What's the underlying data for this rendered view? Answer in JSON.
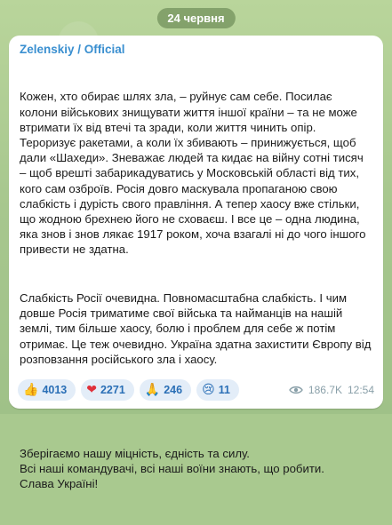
{
  "date_label": "24 червня",
  "channel": "Zelenskiy / Official",
  "paragraphs": [
    "Кожен, хто обирає шлях зла, – руйнує сам себе. Посилає колони військових знищувати життя іншої країни – та не може втримати їх від втечі та зради, коли життя чинить опір. Тероризує ракетами, а коли їх збивають – принижується, щоб дали «Шахеди». Зневажає людей та кидає на війну сотні тисяч – щоб врешті забарикадуватись у Московській області від тих, кого сам озброїв. Росія довго маскувала пропаганою свою слабкість і дурість свого правління. А тепер хаосу вже стільки, що жодною брехнею його не сховаєш. І все це – одна людина, яка знов і знов лякає 1917 роком, хоча взагалі ні до чого іншого привести не здатна.",
    "Слабкість Росії очевидна. Повномасштабна слабкість. І чим довше Росія триматиме свої війська та найманців на нашій землі, тим більше хаосу, болю і проблем для себе ж потім отримає. Це теж очевидно. Україна здатна захистити Європу від розповзання російського зла і хаосу.",
    "Зберігаємо нашу міцність, єдність та силу.\nВсі наші командувачі, всі наші воїни знають, що робити.\nСлава Україні!"
  ],
  "reactions": [
    {
      "emoji": "👍",
      "count": "4013"
    },
    {
      "emoji": "❤",
      "count": "2271"
    },
    {
      "emoji": "🙏",
      "count": "246"
    },
    {
      "emoji": "😢",
      "count": "11"
    }
  ],
  "views": "186.7K",
  "time": "12:54",
  "colors": {
    "accent": "#3a8fd0",
    "background": "#a9c98f"
  },
  "icons": {
    "views": "eye-icon"
  }
}
